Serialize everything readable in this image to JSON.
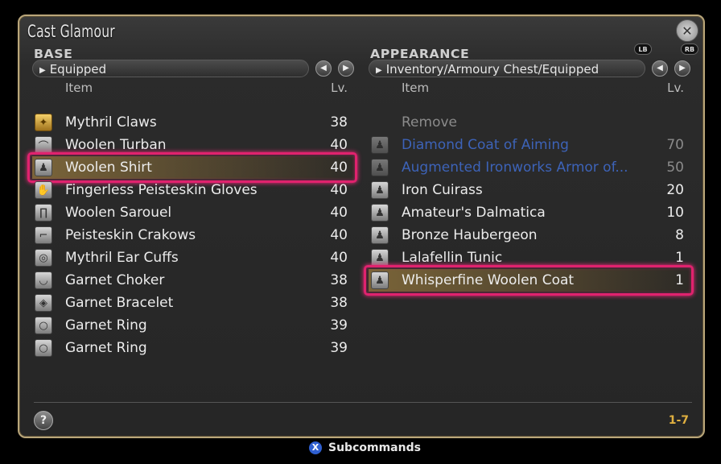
{
  "window": {
    "title": "Cast Glamour",
    "close_icon": "gear-close-icon"
  },
  "base": {
    "label": "BASE",
    "filter": "Equipped",
    "col_item": "Item",
    "col_lv": "Lv.",
    "items": [
      {
        "name": "Mythril Claws",
        "lv": "38",
        "icon": "weapon-claws-icon",
        "style": "gold"
      },
      {
        "name": "Woolen Turban",
        "lv": "40",
        "icon": "head-icon",
        "style": "gear"
      },
      {
        "name": "Woolen Shirt",
        "lv": "40",
        "icon": "body-icon",
        "style": "gear",
        "selected": true
      },
      {
        "name": "Fingerless Peisteskin Gloves",
        "lv": "40",
        "icon": "hands-icon",
        "style": "gear"
      },
      {
        "name": "Woolen Sarouel",
        "lv": "40",
        "icon": "legs-icon",
        "style": "gear"
      },
      {
        "name": "Peisteskin Crakows",
        "lv": "40",
        "icon": "feet-icon",
        "style": "gear"
      },
      {
        "name": "Mythril Ear Cuffs",
        "lv": "40",
        "icon": "earrings-icon",
        "style": "gear"
      },
      {
        "name": "Garnet Choker",
        "lv": "38",
        "icon": "necklace-icon",
        "style": "gear"
      },
      {
        "name": "Garnet Bracelet",
        "lv": "38",
        "icon": "bracelet-icon",
        "style": "gear"
      },
      {
        "name": "Garnet Ring",
        "lv": "39",
        "icon": "ring-icon",
        "style": "gear"
      },
      {
        "name": "Garnet Ring",
        "lv": "39",
        "icon": "ring-icon",
        "style": "gear"
      }
    ]
  },
  "appearance": {
    "label": "APPEARANCE",
    "filter": "Inventory/Armoury Chest/Equipped",
    "lb": "LB",
    "rb": "RB",
    "col_item": "Item",
    "col_lv": "Lv.",
    "items": [
      {
        "name": "Remove",
        "lv": "",
        "icon": "",
        "style": "none",
        "tone": "muted"
      },
      {
        "name": "Diamond Coat of Aiming",
        "lv": "70",
        "icon": "body-icon",
        "style": "dim",
        "tone": "blue",
        "lvtone": "muted"
      },
      {
        "name": "Augmented Ironworks Armor of...",
        "lv": "50",
        "icon": "body-icon",
        "style": "dim",
        "tone": "blue",
        "lvtone": "muted"
      },
      {
        "name": "Iron Cuirass",
        "lv": "20",
        "icon": "body-icon",
        "style": "gear"
      },
      {
        "name": "Amateur's Dalmatica",
        "lv": "10",
        "icon": "body-icon",
        "style": "gear"
      },
      {
        "name": "Bronze Haubergeon",
        "lv": "8",
        "icon": "body-icon",
        "style": "gear"
      },
      {
        "name": "Lalafellin Tunic",
        "lv": "1",
        "icon": "body-icon",
        "style": "gear"
      },
      {
        "name": "Whisperfine Woolen Coat",
        "lv": "1",
        "icon": "body-icon",
        "style": "gear",
        "selected": true
      }
    ]
  },
  "footer": {
    "help": "?",
    "page_count": "1-7"
  },
  "subcommands": {
    "button": "X",
    "label": "Subcommands"
  }
}
